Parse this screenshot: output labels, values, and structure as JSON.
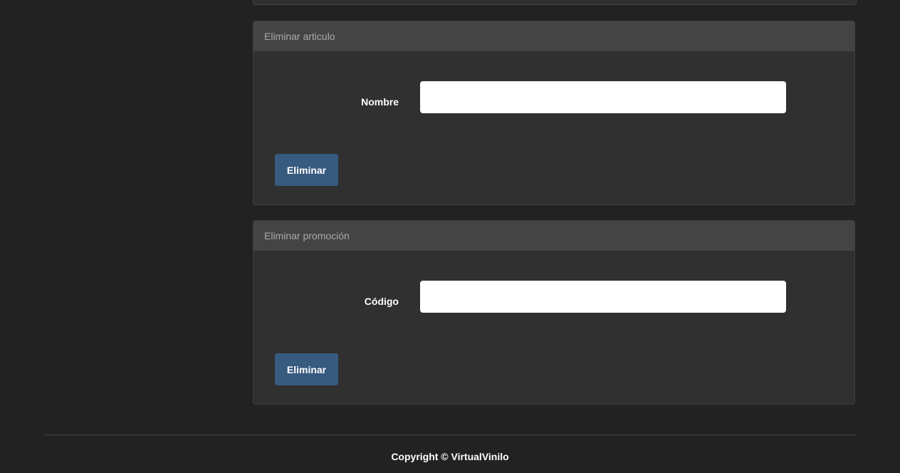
{
  "panels": [
    {
      "title": "Eliminar articulo",
      "field_label": "Nombre",
      "field_value": "",
      "button_label": "Eliminar"
    },
    {
      "title": "Eliminar promoción",
      "field_label": "Código",
      "field_value": "",
      "button_label": "Eliminar"
    }
  ],
  "footer": {
    "copyright": "Copyright © VirtualVinilo"
  },
  "colors": {
    "background": "#222222",
    "panel": "#303030",
    "panel_heading": "#444444",
    "button": "#375a7f"
  }
}
